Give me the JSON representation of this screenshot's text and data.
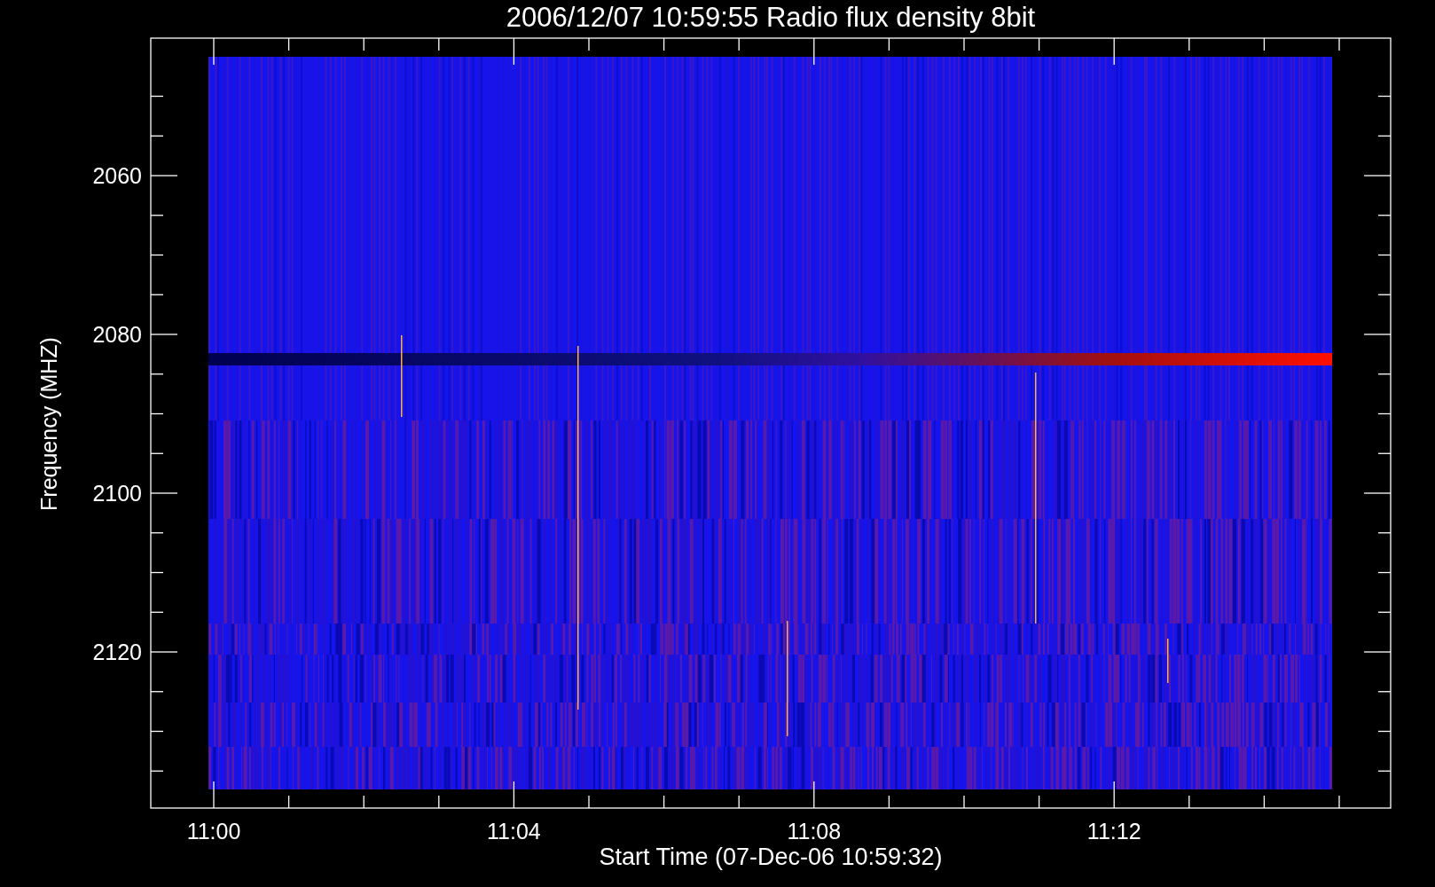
{
  "plot": {
    "title": "2006/12/07 10:59:55 Radio flux density 8bit",
    "y_axis": {
      "label": "Frequency (MHZ)",
      "tick_labels": [
        "2060",
        "2080",
        "2100",
        "2120"
      ]
    },
    "x_axis": {
      "label": "Start Time (07-Dec-06 10:59:32)",
      "tick_labels": [
        "11:00",
        "11:04",
        "11:08",
        "11:12"
      ]
    }
  }
}
